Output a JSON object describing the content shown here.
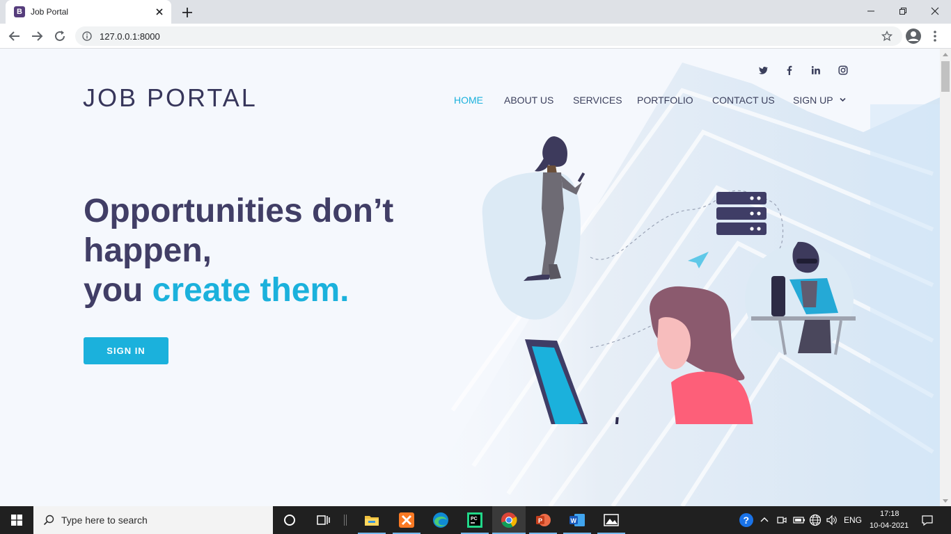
{
  "browser": {
    "tab_title": "Job Portal",
    "tab_favicon": "B",
    "url": "127.0.0.1:8000"
  },
  "site": {
    "logo": "JOB PORTAL",
    "social_icons": [
      "twitter-icon",
      "facebook-icon",
      "linkedin-icon",
      "instagram-icon"
    ],
    "nav": [
      {
        "label": "HOME",
        "active": true
      },
      {
        "label": "ABOUT US",
        "active": false
      },
      {
        "label": "SERVICES",
        "active": false
      },
      {
        "label": "PORTFOLIO",
        "active": false
      },
      {
        "label": "CONTACT US",
        "active": false
      },
      {
        "label": "SIGN UP",
        "active": false,
        "dropdown": true
      }
    ],
    "hero": {
      "line1": "Opportunities don’t",
      "line2": "happen,",
      "line3_plain": "you ",
      "line3_accent": "create them."
    },
    "cta_label": "SIGN IN",
    "colors": {
      "accent": "#1bb1dc",
      "heading": "#413e66",
      "nav": "#3b3f5c",
      "background": "#f5f8fd"
    }
  },
  "taskbar": {
    "search_placeholder": "Type here to search",
    "apps": [
      "task-view-icon",
      "file-explorer-icon",
      "xampp-icon",
      "edge-icon",
      "pycharm-icon",
      "chrome-icon",
      "powerpoint-icon",
      "word-icon",
      "photos-icon"
    ],
    "language": "ENG",
    "time": "17:18",
    "date": "10-04-2021"
  }
}
